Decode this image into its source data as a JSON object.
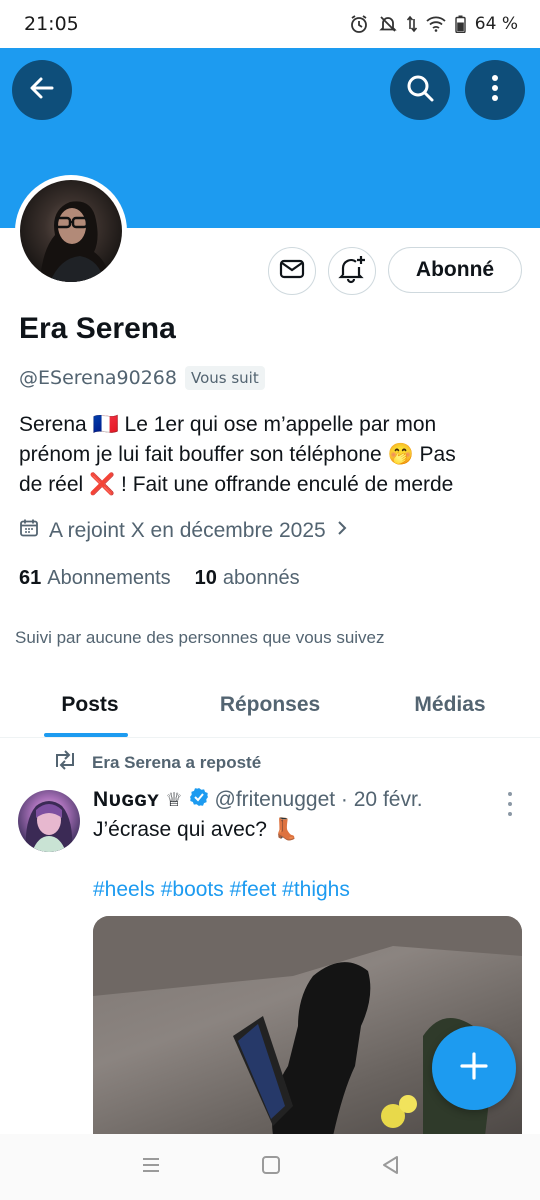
{
  "status_bar": {
    "time": "21:05",
    "battery": "64 %",
    "icons": [
      "alarm-icon",
      "mute-notifications-icon",
      "data-arrows-icon",
      "wifi-icon",
      "battery-icon"
    ]
  },
  "header": {
    "back_icon": "arrow-left-icon",
    "search_icon": "search-icon",
    "more_icon": "vertical-dots-icon",
    "banner_color": "#1d9bf0"
  },
  "profile": {
    "display_name": "Era Serena",
    "handle": "@ESerena90268",
    "follows_you": "Vous suit",
    "follow_button": "Abonné",
    "bio_lines": [
      "Serena 🇫🇷  Le 1er qui ose m’appelle par mon",
      "prénom je lui fait bouffer son téléphone 🤭  Pas",
      "de réel ❌ !   Fait une offrande enculé de merde"
    ],
    "joined": "A rejoint X en décembre 2025",
    "following_count": "61",
    "following_label": "Abonnements",
    "followers_count": "10",
    "followers_label": "abonnés",
    "followed_by": "Suivi par aucune des personnes que vous suivez"
  },
  "tabs": [
    {
      "label": "Posts",
      "active": true
    },
    {
      "label": "Réponses",
      "active": false
    },
    {
      "label": "Médias",
      "active": false
    }
  ],
  "post": {
    "repost_label": "Era Serena a reposté",
    "author": "Nᴜɢɢʏ",
    "author_crown": "♕",
    "handle_date": "@fritenugget · 20 févr.",
    "text": "J’écrase qui avec? 👢",
    "tags": "#heels #boots #feet #thighs"
  },
  "colors": {
    "accent": "#1d9bf0",
    "header_button": "#0e4e7a",
    "secondary_text": "#536471"
  }
}
